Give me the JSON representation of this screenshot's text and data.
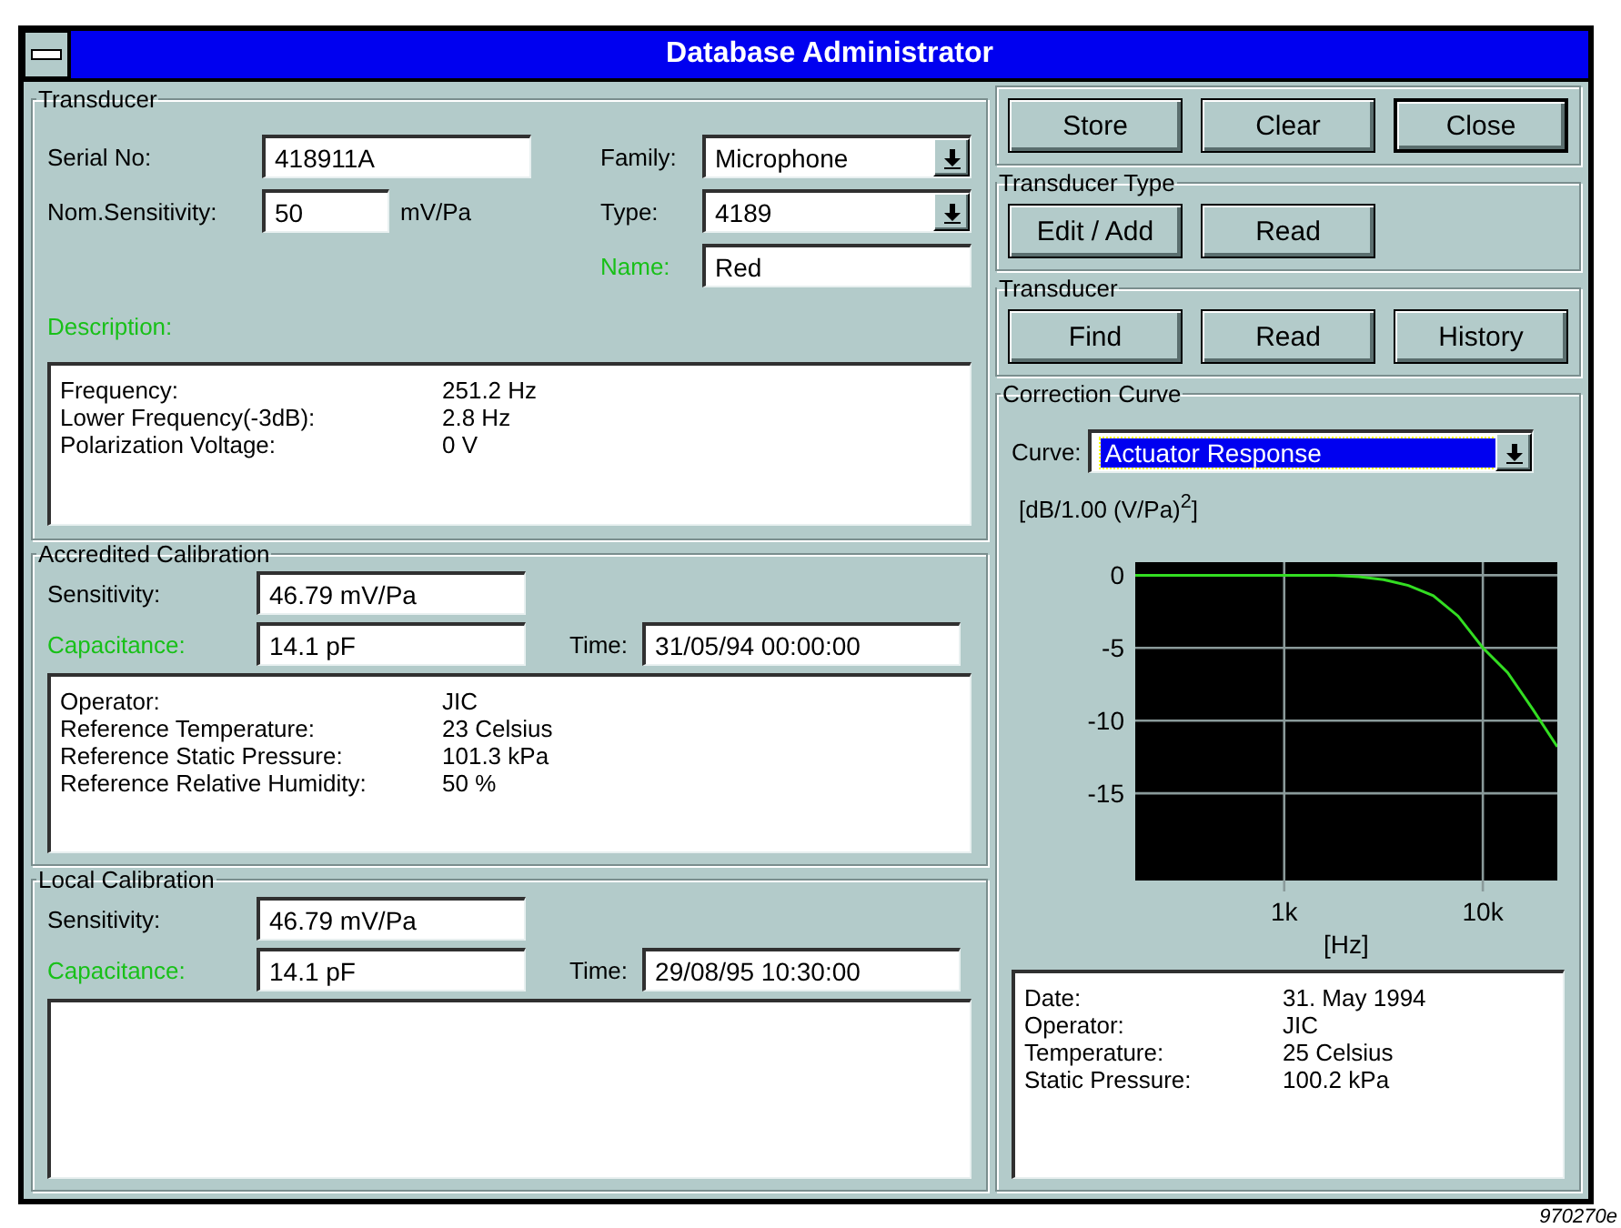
{
  "window": {
    "title": "Database Administrator"
  },
  "transducer": {
    "title": "Transducer",
    "left_fields": [
      {
        "label": "Serial No:",
        "value": "418911A",
        "highlighted": false
      },
      {
        "label": "Nom.Sensitivity:",
        "value": "50",
        "unit": "mV/Pa",
        "highlighted": false
      }
    ],
    "right_fields": [
      {
        "label": "Family:",
        "value": "Microphone",
        "kind": "dropdown",
        "highlighted": false
      },
      {
        "label": "Type:",
        "value": "4189",
        "kind": "dropdown",
        "highlighted": false
      },
      {
        "label": "Name:",
        "value": "Red",
        "kind": "text",
        "highlighted": true
      }
    ],
    "description_label": {
      "text": "Description:",
      "highlighted": true
    },
    "description": [
      {
        "label": "Frequency:",
        "value": "251.2 Hz"
      },
      {
        "label": "Lower Frequency(-3dB):",
        "value": "2.8 Hz"
      },
      {
        "label": "Polarization Voltage:",
        "value": "0 V"
      }
    ]
  },
  "calibrations": [
    {
      "title": "Accredited Calibration",
      "sensitivity": {
        "label": "Sensitivity:",
        "value": "46.79 mV/Pa",
        "highlighted": false
      },
      "capacitance": {
        "label": "Capacitance:",
        "value": "14.1 pF",
        "highlighted": true
      },
      "time": {
        "label": "Time:",
        "value": "31/05/94 00:00:00",
        "highlighted": false
      },
      "details": [
        {
          "label": "Operator:",
          "value": "JIC"
        },
        {
          "label": "Reference Temperature:",
          "value": "23 Celsius"
        },
        {
          "label": "Reference Static Pressure:",
          "value": "101.3 kPa"
        },
        {
          "label": "Reference Relative Humidity:",
          "value": "50 %"
        }
      ]
    },
    {
      "title": "Local Calibration",
      "sensitivity": {
        "label": "Sensitivity:",
        "value": "46.79 mV/Pa",
        "highlighted": false
      },
      "capacitance": {
        "label": "Capacitance:",
        "value": "14.1 pF",
        "highlighted": true
      },
      "time": {
        "label": "Time:",
        "value": "29/08/95 10:30:00",
        "highlighted": false
      }
    }
  ],
  "actions": [
    {
      "label": "Store",
      "default": false
    },
    {
      "label": "Clear",
      "default": false
    },
    {
      "label": "Close",
      "default": true
    }
  ],
  "transducer_type": {
    "title": "Transducer Type",
    "buttons": [
      {
        "label": "Edit / Add",
        "default": false
      },
      {
        "label": "Read",
        "default": false
      }
    ]
  },
  "transducer_actions": {
    "title": "Transducer",
    "buttons": [
      {
        "label": "Find",
        "default": false
      },
      {
        "label": "Read",
        "default": false
      },
      {
        "label": "History",
        "default": false
      }
    ]
  },
  "correction_curve": {
    "title": "Correction Curve",
    "curve": {
      "label": "Curve:",
      "value": "Actuator Response",
      "focused": true
    },
    "chart_data": {
      "type": "line",
      "ylabel": "[dB/1.00 (V/Pa)$^{2}$]",
      "xlabel": "[Hz]",
      "categories": [
        null,
        null,
        null,
        null,
        null,
        null,
        "1k",
        null,
        null,
        null,
        null,
        null,
        null,
        null,
        "10k",
        null,
        null,
        null
      ],
      "series": [
        {
          "color": "#33dd22",
          "values": [
            0,
            0,
            0,
            0,
            0,
            0,
            0,
            0,
            0,
            -0.1,
            -0.3,
            -0.7,
            -1.4,
            -2.8,
            -5,
            -6.7,
            -9.2,
            -11.8
          ]
        }
      ],
      "ylim": [
        -21,
        0.9
      ],
      "grid": true,
      "yticks": [
        0,
        -5,
        -10,
        -15
      ]
    },
    "details": [
      {
        "label": "Date:",
        "value": "31. May 1994"
      },
      {
        "label": "Operator:",
        "value": "JIC"
      },
      {
        "label": "Temperature:",
        "value": "25 Celsius"
      },
      {
        "label": "Static Pressure:",
        "value": "100.2 kPa"
      }
    ]
  },
  "figure_code": "970270e"
}
